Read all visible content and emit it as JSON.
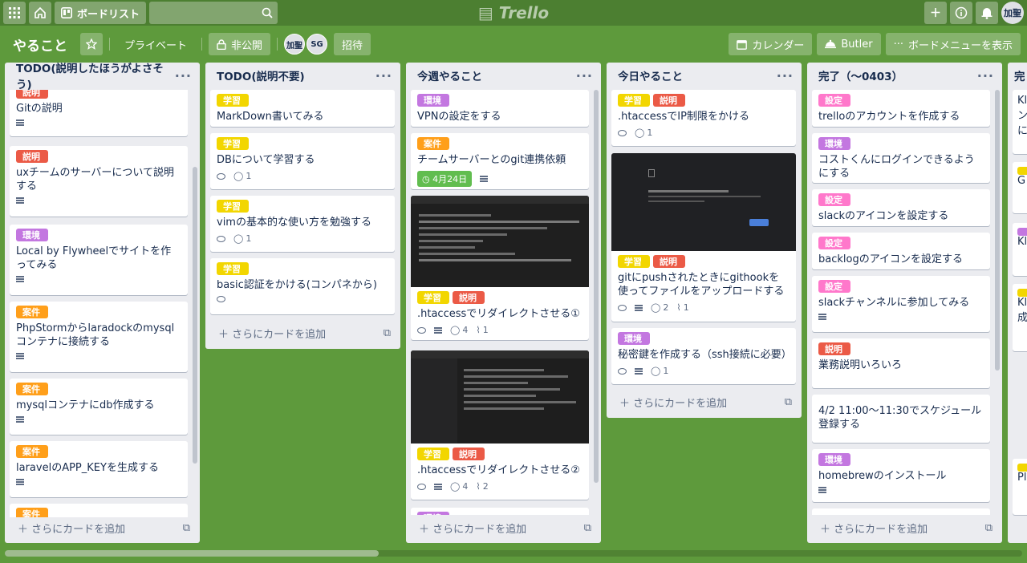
{
  "topbar": {
    "board_button": "ボードリスト",
    "logo": "Trello",
    "avatar": "加聖"
  },
  "boardbar": {
    "title": "やること",
    "visibility": "プライベート",
    "team": "非公開",
    "members": [
      "加聖",
      "SG"
    ],
    "invite": "招待",
    "calendar": "カレンダー",
    "butler": "Butler",
    "menu": "ボードメニューを表示"
  },
  "labels": {
    "colors": {
      "説明": "#eb5a46",
      "学習": "#f2d600",
      "環境": "#c377e0",
      "案件": "#ff9f1a",
      "設定": "#ff78cb"
    }
  },
  "add_card_label": "さらにカードを追加",
  "lists": [
    {
      "title": "TODO(説明したほうがよさそう)",
      "cards": [
        {
          "labels": [
            "説明"
          ],
          "title": "Gitの説明",
          "desc": true
        },
        {
          "labels": [
            "説明"
          ],
          "title": "uxチームのサーバーについて説明する",
          "desc": true
        },
        {
          "labels": [
            "環境"
          ],
          "title": "Local by Flywheelでサイトを作ってみる",
          "desc": true
        },
        {
          "labels": [
            "案件"
          ],
          "title": "PhpStormからlaradockのmysqlコンテナに接続する",
          "desc": true
        },
        {
          "labels": [
            "案件"
          ],
          "title": "mysqlコンテナにdb作成する",
          "desc": true
        },
        {
          "labels": [
            "案件"
          ],
          "title": "laravelのAPP_KEYを生成する",
          "desc": true
        },
        {
          "labels": [
            "案件"
          ],
          "title": "",
          "desc": false
        }
      ]
    },
    {
      "title": "TODO(説明不要)",
      "cards": [
        {
          "labels": [
            "学習"
          ],
          "title": "MarkDown書いてみる"
        },
        {
          "labels": [
            "学習"
          ],
          "title": "DBについて学習する",
          "watch": true,
          "comments": "1"
        },
        {
          "labels": [
            "学習"
          ],
          "title": "vimの基本的な使い方を勉強する",
          "watch": true,
          "comments": "1"
        },
        {
          "labels": [
            "学習"
          ],
          "title": "basic認証をかける(コンパネから)",
          "watch": true
        }
      ]
    },
    {
      "title": "今週やること",
      "cards": [
        {
          "labels": [
            "環境"
          ],
          "title": "VPNの設定をする"
        },
        {
          "labels": [
            "案件"
          ],
          "title": "チームサーバーとのgit連携依頼",
          "due": "4月24日",
          "desc": true
        },
        {
          "labels": [
            "学習",
            "説明"
          ],
          "title": ".htaccessでリダイレクトさせる①",
          "watch": true,
          "desc": true,
          "comments": "4",
          "attachments": "1"
        },
        {
          "labels": [
            "学習",
            "説明"
          ],
          "title": ".htaccessでリダイレクトさせる②",
          "watch": true,
          "desc": true,
          "comments": "4",
          "attachments": "2"
        },
        {
          "labels": [
            "環境"
          ],
          "title": ""
        }
      ]
    },
    {
      "title": "今日やること",
      "cards": [
        {
          "labels": [
            "学習",
            "説明"
          ],
          "title": ".htaccessでIP制限をかける",
          "watch": true,
          "comments": "1"
        },
        {
          "labels": [
            "学習",
            "説明"
          ],
          "title": "gitにpushされたときにgithookを使ってファイルをアップロードする",
          "watch": true,
          "desc": true,
          "comments": "2",
          "attachments": "1"
        },
        {
          "labels": [
            "環境"
          ],
          "title": "秘密鍵を作成する（ssh接続に必要）",
          "watch": true,
          "desc": true,
          "comments": "1"
        }
      ]
    },
    {
      "title": "完了（〜0403）",
      "cards": [
        {
          "labels": [
            "設定"
          ],
          "title": "trelloのアカウントを作成する"
        },
        {
          "labels": [
            "環境"
          ],
          "title": "コストくんにログインできるようにする"
        },
        {
          "labels": [
            "設定"
          ],
          "title": "slackのアイコンを設定する"
        },
        {
          "labels": [
            "設定"
          ],
          "title": "backlogのアイコンを設定する"
        },
        {
          "labels": [
            "設定"
          ],
          "title": "slackチャンネルに参加してみる",
          "desc": true
        },
        {
          "labels": [
            "説明"
          ],
          "title": "業務説明いろいろ"
        },
        {
          "labels": [],
          "title": "4/2 11:00〜11:30でスケジュール登録する"
        },
        {
          "labels": [
            "環境"
          ],
          "title": "homebrewのインストール",
          "desc": true
        }
      ]
    }
  ],
  "partial_list": {
    "title": "完",
    "snippets": [
      "Kl",
      "ン",
      "に",
      "G",
      "Kl",
      "Kl",
      "成",
      "Pl"
    ]
  }
}
